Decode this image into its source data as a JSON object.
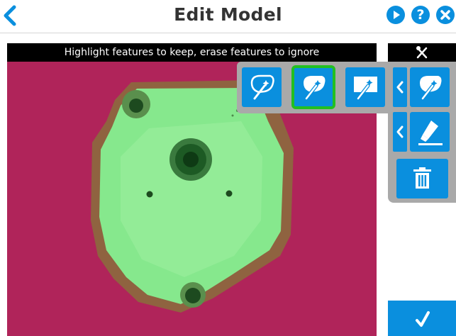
{
  "header": {
    "title": "Edit Model",
    "back_icon": "chevron-left-icon",
    "play_icon": "play-icon",
    "help_label": "?",
    "close_icon": "close-icon"
  },
  "canvas": {
    "banner_text": "Highlight features to keep, erase features to ignore",
    "background_color": "#b0245a",
    "highlight_color": "#86e88d"
  },
  "brush_popup": {
    "options": [
      {
        "icon": "magic-wand-outline-icon",
        "selected": false
      },
      {
        "icon": "magic-wand-fill-icon",
        "selected": true
      },
      {
        "icon": "magic-wand-rect-icon",
        "selected": false
      }
    ]
  },
  "tool_panel": {
    "header_icon": "tools-icon",
    "tools": [
      {
        "icon": "magic-wand-fill-icon",
        "has_expand_arrow": true
      },
      {
        "icon": "highlighter-icon",
        "has_expand_arrow": true
      },
      {
        "icon": "trash-icon",
        "has_expand_arrow": false
      }
    ]
  },
  "confirm_icon": "checkmark-icon",
  "colors": {
    "accent": "#0a8fde",
    "selected_outline": "#22c021",
    "panel_gray": "#a9a9a9"
  }
}
